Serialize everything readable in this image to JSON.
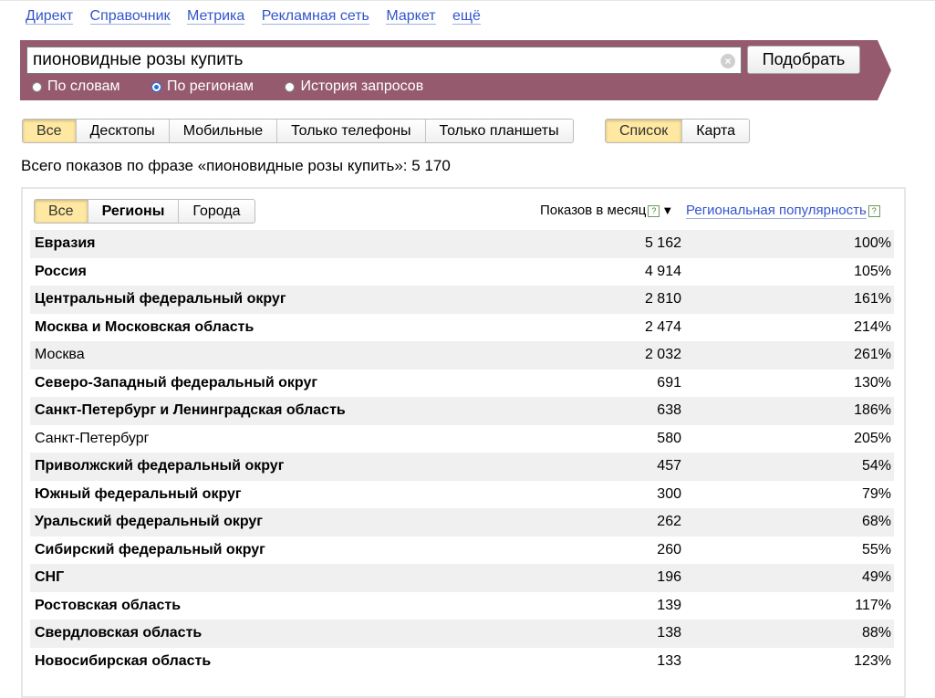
{
  "top_nav": [
    "Директ",
    "Справочник",
    "Метрика",
    "Рекламная сеть",
    "Маркет",
    "ещё"
  ],
  "search": {
    "value": "пионовидные розы купить",
    "submit_label": "Подобрать",
    "clear_icon": "clear-icon",
    "modes": [
      {
        "label": "По словам",
        "selected": false
      },
      {
        "label": "По регионам",
        "selected": true
      },
      {
        "label": "История запросов",
        "selected": false
      }
    ]
  },
  "device_tabs": [
    "Все",
    "Десктопы",
    "Мобильные",
    "Только телефоны",
    "Только планшеты"
  ],
  "device_selected": "Все",
  "view_tabs": [
    "Список",
    "Карта"
  ],
  "view_selected": "Список",
  "total_text": "Всего показов по фразе «пионовидные розы купить»: 5 170",
  "region_tabs": [
    "Все",
    "Регионы",
    "Города"
  ],
  "region_selected": "Все",
  "columns": {
    "shows": "Показов в месяц",
    "popularity": "Региональная популярность",
    "help": "?",
    "sort": "▼"
  },
  "rows": [
    {
      "name": "Евразия",
      "shows": "5 162",
      "pop": "100%",
      "bold": true
    },
    {
      "name": "Россия",
      "shows": "4 914",
      "pop": "105%",
      "bold": true
    },
    {
      "name": "Центральный федеральный округ",
      "shows": "2 810",
      "pop": "161%",
      "bold": true
    },
    {
      "name": "Москва и Московская область",
      "shows": "2 474",
      "pop": "214%",
      "bold": true
    },
    {
      "name": "Москва",
      "shows": "2 032",
      "pop": "261%",
      "bold": false
    },
    {
      "name": "Северо-Западный федеральный округ",
      "shows": "691",
      "pop": "130%",
      "bold": true
    },
    {
      "name": "Санкт-Петербург и Ленинградская область",
      "shows": "638",
      "pop": "186%",
      "bold": true
    },
    {
      "name": "Санкт-Петербург",
      "shows": "580",
      "pop": "205%",
      "bold": false
    },
    {
      "name": "Приволжский федеральный округ",
      "shows": "457",
      "pop": "54%",
      "bold": true
    },
    {
      "name": "Южный федеральный округ",
      "shows": "300",
      "pop": "79%",
      "bold": true
    },
    {
      "name": "Уральский федеральный округ",
      "shows": "262",
      "pop": "68%",
      "bold": true
    },
    {
      "name": "Сибирский федеральный округ",
      "shows": "260",
      "pop": "55%",
      "bold": true
    },
    {
      "name": "СНГ",
      "shows": "196",
      "pop": "49%",
      "bold": true
    },
    {
      "name": "Ростовская область",
      "shows": "139",
      "pop": "117%",
      "bold": true
    },
    {
      "name": "Свердловская область",
      "shows": "138",
      "pop": "88%",
      "bold": true
    },
    {
      "name": "Новосибирская область",
      "shows": "133",
      "pop": "123%",
      "bold": true
    }
  ],
  "colors": {
    "band": "#955a6e",
    "selected_tab": "#ffe8a1",
    "link": "#3355cc"
  }
}
